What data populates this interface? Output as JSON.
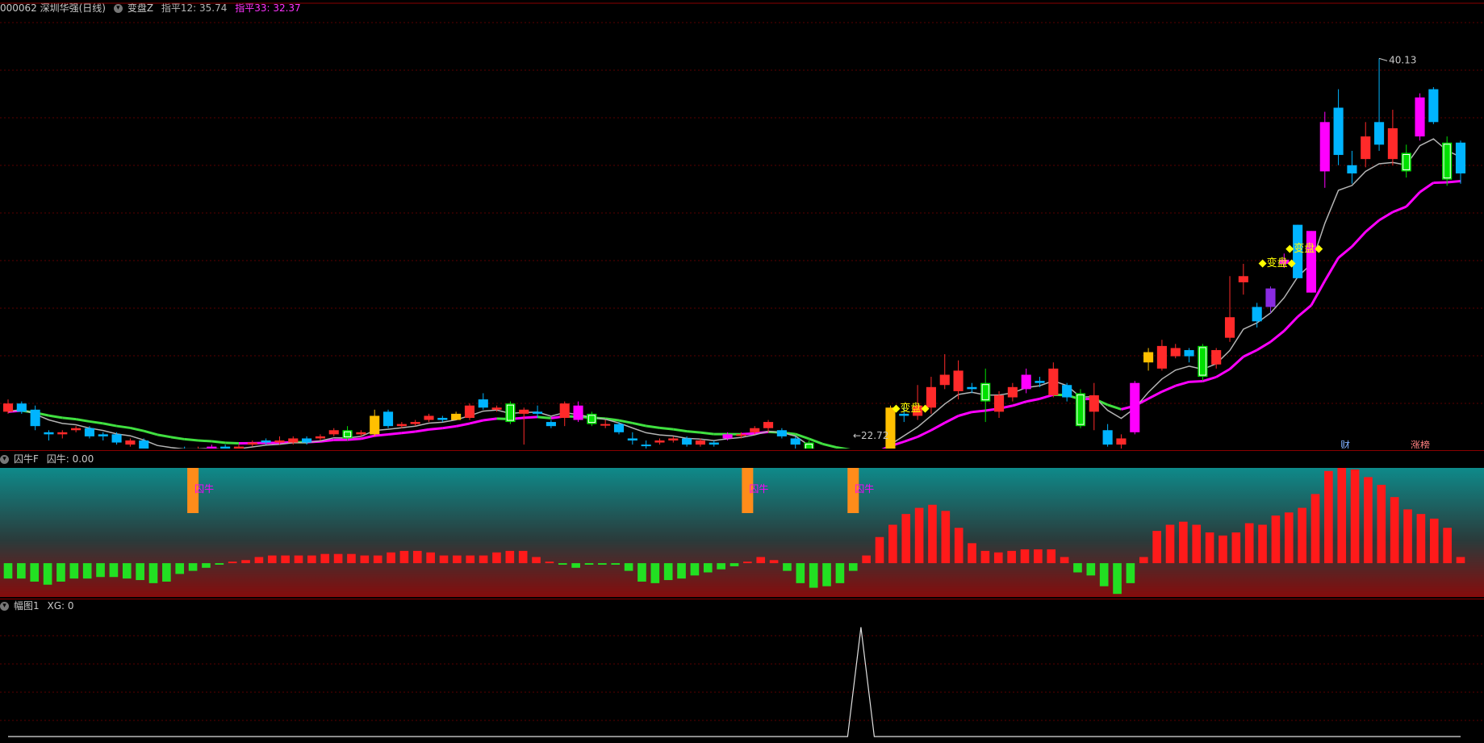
{
  "header": {
    "symbol": "000062 深圳华强(日线)",
    "indicator_name": "变盘Z",
    "line1_text": "指平12: 35.74",
    "line2_text": "指平33: 32.37"
  },
  "annotations": {
    "high_label": "40.13",
    "low_label": "←22.72",
    "signal_label": "◆变盘◆",
    "cai_label": "财",
    "zhangbang_label": "涨榜"
  },
  "panel2": {
    "name": "囚牛F",
    "value_text": "囚牛: 0.00",
    "signal_label": "囚牛"
  },
  "panel3": {
    "name": "幅图1",
    "value_text": "XG: 0"
  },
  "colors": {
    "up": "#ff2a2a",
    "down": "#00b4ff",
    "green_bar": "#00e000",
    "magenta": "#ff00ff",
    "yellow": "#ffc000",
    "orange": "#ff8c1a",
    "ma_gray": "#b4b4b4",
    "ma_green": "#40e040",
    "ma_magenta": "#ff00ff",
    "header_magenta": "#ff33ff",
    "signal_yellow": "#ffff00"
  },
  "chart_data": [
    {
      "type": "candlestick",
      "title": "000062 深圳华强(日线)",
      "ylim": [
        21.5,
        42.0
      ],
      "candles": [
        {
          "o": 23.3,
          "c": 22.9,
          "h": 23.5,
          "l": 22.8,
          "k": "up"
        },
        {
          "o": 22.9,
          "c": 23.3,
          "h": 23.4,
          "l": 22.8,
          "k": "down"
        },
        {
          "o": 23.0,
          "c": 22.2,
          "h": 23.2,
          "l": 22.0,
          "k": "down"
        },
        {
          "o": 21.9,
          "c": 21.8,
          "h": 22.0,
          "l": 21.5,
          "k": "down"
        },
        {
          "o": 21.8,
          "c": 21.9,
          "h": 22.0,
          "l": 21.6,
          "k": "up"
        },
        {
          "o": 22.0,
          "c": 22.1,
          "h": 22.2,
          "l": 21.9,
          "k": "up"
        },
        {
          "o": 22.1,
          "c": 21.7,
          "h": 22.2,
          "l": 21.6,
          "k": "down"
        },
        {
          "o": 21.8,
          "c": 21.7,
          "h": 21.9,
          "l": 21.5,
          "k": "down"
        },
        {
          "o": 21.8,
          "c": 21.4,
          "h": 21.9,
          "l": 21.3,
          "k": "down"
        },
        {
          "o": 21.3,
          "c": 21.5,
          "h": 21.6,
          "l": 21.2,
          "k": "up"
        },
        {
          "o": 21.5,
          "c": 21.0,
          "h": 21.6,
          "l": 21.0,
          "k": "down"
        },
        {
          "o": 21.0,
          "c": 20.6,
          "h": 21.1,
          "l": 20.5,
          "k": "down"
        },
        {
          "o": 20.6,
          "c": 20.9,
          "h": 21.0,
          "l": 20.4,
          "k": "up"
        },
        {
          "o": 20.9,
          "c": 20.9,
          "h": 21.2,
          "l": 20.7,
          "k": "down"
        },
        {
          "o": 20.9,
          "c": 21.1,
          "h": 21.2,
          "l": 20.8,
          "k": "up"
        },
        {
          "o": 21.1,
          "c": 21.2,
          "h": 21.3,
          "l": 21.0,
          "k": "magenta"
        },
        {
          "o": 21.2,
          "c": 20.9,
          "h": 21.3,
          "l": 20.8,
          "k": "down"
        },
        {
          "o": 21.0,
          "c": 21.2,
          "h": 21.3,
          "l": 20.9,
          "k": "up"
        },
        {
          "o": 21.3,
          "c": 21.4,
          "h": 21.5,
          "l": 21.2,
          "k": "up"
        },
        {
          "o": 21.4,
          "c": 21.5,
          "h": 21.6,
          "l": 21.3,
          "k": "down"
        },
        {
          "o": 21.5,
          "c": 21.4,
          "h": 21.7,
          "l": 21.3,
          "k": "up"
        },
        {
          "o": 21.4,
          "c": 21.6,
          "h": 21.7,
          "l": 21.3,
          "k": "up"
        },
        {
          "o": 21.6,
          "c": 21.4,
          "h": 21.7,
          "l": 21.3,
          "k": "down"
        },
        {
          "o": 21.6,
          "c": 21.7,
          "h": 21.8,
          "l": 21.5,
          "k": "up"
        },
        {
          "o": 21.8,
          "c": 22.0,
          "h": 22.1,
          "l": 21.7,
          "k": "up"
        },
        {
          "o": 22.0,
          "c": 21.6,
          "h": 22.2,
          "l": 21.5,
          "k": "green"
        },
        {
          "o": 21.8,
          "c": 21.9,
          "h": 22.0,
          "l": 21.7,
          "k": "up"
        },
        {
          "o": 21.8,
          "c": 22.7,
          "h": 23.0,
          "l": 21.7,
          "k": "yellow"
        },
        {
          "o": 22.9,
          "c": 22.2,
          "h": 23.0,
          "l": 22.1,
          "k": "down"
        },
        {
          "o": 22.2,
          "c": 22.3,
          "h": 22.4,
          "l": 22.1,
          "k": "up"
        },
        {
          "o": 22.3,
          "c": 22.4,
          "h": 22.5,
          "l": 22.2,
          "k": "up"
        },
        {
          "o": 22.5,
          "c": 22.7,
          "h": 22.8,
          "l": 22.4,
          "k": "up"
        },
        {
          "o": 22.6,
          "c": 22.5,
          "h": 22.7,
          "l": 22.4,
          "k": "down"
        },
        {
          "o": 22.5,
          "c": 22.8,
          "h": 22.9,
          "l": 22.5,
          "k": "yellow"
        },
        {
          "o": 22.6,
          "c": 23.2,
          "h": 23.3,
          "l": 22.5,
          "k": "up"
        },
        {
          "o": 23.1,
          "c": 23.5,
          "h": 23.8,
          "l": 23.0,
          "k": "down"
        },
        {
          "o": 23.0,
          "c": 23.1,
          "h": 23.2,
          "l": 22.9,
          "k": "up"
        },
        {
          "o": 23.3,
          "c": 22.4,
          "h": 23.4,
          "l": 22.3,
          "k": "green"
        },
        {
          "o": 22.8,
          "c": 23.0,
          "h": 23.1,
          "l": 21.3,
          "k": "up"
        },
        {
          "o": 22.8,
          "c": 22.9,
          "h": 23.2,
          "l": 22.6,
          "k": "down"
        },
        {
          "o": 22.4,
          "c": 22.2,
          "h": 22.5,
          "l": 22.1,
          "k": "down"
        },
        {
          "o": 22.6,
          "c": 23.3,
          "h": 23.4,
          "l": 22.2,
          "k": "up"
        },
        {
          "o": 23.2,
          "c": 22.5,
          "h": 23.4,
          "l": 22.4,
          "k": "magenta"
        },
        {
          "o": 22.8,
          "c": 22.3,
          "h": 22.9,
          "l": 22.2,
          "k": "green"
        },
        {
          "o": 22.3,
          "c": 22.3,
          "h": 22.5,
          "l": 22.1,
          "k": "up"
        },
        {
          "o": 22.3,
          "c": 21.9,
          "h": 22.4,
          "l": 21.8,
          "k": "down"
        },
        {
          "o": 21.6,
          "c": 21.5,
          "h": 21.9,
          "l": 21.3,
          "k": "down"
        },
        {
          "o": 21.3,
          "c": 21.3,
          "h": 21.5,
          "l": 21.0,
          "k": "down"
        },
        {
          "o": 21.4,
          "c": 21.5,
          "h": 21.6,
          "l": 21.3,
          "k": "up"
        },
        {
          "o": 21.5,
          "c": 21.6,
          "h": 21.7,
          "l": 21.4,
          "k": "up"
        },
        {
          "o": 21.6,
          "c": 21.3,
          "h": 21.7,
          "l": 21.2,
          "k": "down"
        },
        {
          "o": 21.3,
          "c": 21.5,
          "h": 21.6,
          "l": 21.2,
          "k": "up"
        },
        {
          "o": 21.4,
          "c": 21.3,
          "h": 21.5,
          "l": 21.2,
          "k": "down"
        },
        {
          "o": 21.6,
          "c": 21.8,
          "h": 21.9,
          "l": 21.5,
          "k": "magenta"
        },
        {
          "o": 21.8,
          "c": 21.8,
          "h": 21.9,
          "l": 21.6,
          "k": "up"
        },
        {
          "o": 21.9,
          "c": 22.1,
          "h": 22.2,
          "l": 21.8,
          "k": "up"
        },
        {
          "o": 22.1,
          "c": 22.4,
          "h": 22.5,
          "l": 21.9,
          "k": "up"
        },
        {
          "o": 22.0,
          "c": 21.7,
          "h": 22.1,
          "l": 21.6,
          "k": "down"
        },
        {
          "o": 21.6,
          "c": 21.3,
          "h": 21.7,
          "l": 21.0,
          "k": "down"
        },
        {
          "o": 21.4,
          "c": 20.1,
          "h": 21.5,
          "l": 20.0,
          "k": "green"
        },
        {
          "o": 20.1,
          "c": 19.7,
          "h": 20.2,
          "l": 19.6,
          "k": "down"
        },
        {
          "o": 19.9,
          "c": 20.1,
          "h": 20.2,
          "l": 19.8,
          "k": "up"
        },
        {
          "o": 20.0,
          "c": 20.3,
          "h": 20.4,
          "l": 19.8,
          "k": "up"
        },
        {
          "o": 20.0,
          "c": 20.3,
          "h": 20.5,
          "l": 19.9,
          "k": "up"
        },
        {
          "o": 20.8,
          "c": 20.9,
          "h": 21.0,
          "l": 20.6,
          "k": "up"
        },
        {
          "o": 20.7,
          "c": 23.1,
          "h": 23.2,
          "l": 20.6,
          "k": "yellow"
        },
        {
          "o": 22.7,
          "c": 22.8,
          "h": 23.2,
          "l": 22.4,
          "k": "down"
        },
        {
          "o": 22.7,
          "c": 23.2,
          "h": 24.2,
          "l": 22.5,
          "k": "up"
        },
        {
          "o": 23.1,
          "c": 24.1,
          "h": 24.6,
          "l": 22.8,
          "k": "up"
        },
        {
          "o": 24.2,
          "c": 24.7,
          "h": 25.7,
          "l": 24.0,
          "k": "up"
        },
        {
          "o": 23.9,
          "c": 24.9,
          "h": 25.4,
          "l": 23.5,
          "k": "up"
        },
        {
          "o": 24.0,
          "c": 24.1,
          "h": 24.3,
          "l": 23.8,
          "k": "down"
        },
        {
          "o": 24.3,
          "c": 23.4,
          "h": 25.0,
          "l": 22.4,
          "k": "green"
        },
        {
          "o": 22.9,
          "c": 23.7,
          "h": 23.9,
          "l": 22.6,
          "k": "up"
        },
        {
          "o": 23.6,
          "c": 24.1,
          "h": 24.3,
          "l": 23.4,
          "k": "up"
        },
        {
          "o": 24.0,
          "c": 24.7,
          "h": 25.0,
          "l": 23.8,
          "k": "magenta"
        },
        {
          "o": 24.3,
          "c": 24.4,
          "h": 24.6,
          "l": 24.1,
          "k": "down"
        },
        {
          "o": 23.7,
          "c": 25.0,
          "h": 25.3,
          "l": 23.6,
          "k": "up"
        },
        {
          "o": 24.2,
          "c": 23.6,
          "h": 24.3,
          "l": 23.4,
          "k": "down"
        },
        {
          "o": 23.8,
          "c": 22.2,
          "h": 24.0,
          "l": 22.1,
          "k": "green"
        },
        {
          "o": 22.9,
          "c": 23.7,
          "h": 24.3,
          "l": 22.0,
          "k": "up"
        },
        {
          "o": 22.0,
          "c": 21.3,
          "h": 22.3,
          "l": 21.2,
          "k": "down"
        },
        {
          "o": 21.3,
          "c": 21.6,
          "h": 21.8,
          "l": 21.0,
          "k": "up"
        },
        {
          "o": 21.9,
          "c": 24.3,
          "h": 24.4,
          "l": 21.8,
          "k": "magenta"
        },
        {
          "o": 25.3,
          "c": 25.8,
          "h": 26.0,
          "l": 24.9,
          "k": "yellow"
        },
        {
          "o": 25.0,
          "c": 26.1,
          "h": 26.4,
          "l": 24.9,
          "k": "up"
        },
        {
          "o": 25.6,
          "c": 26.0,
          "h": 26.2,
          "l": 25.5,
          "k": "up"
        },
        {
          "o": 25.9,
          "c": 25.6,
          "h": 26.0,
          "l": 25.3,
          "k": "down"
        },
        {
          "o": 26.1,
          "c": 24.6,
          "h": 26.2,
          "l": 24.4,
          "k": "green"
        },
        {
          "o": 25.2,
          "c": 25.9,
          "h": 26.0,
          "l": 25.0,
          "k": "up"
        },
        {
          "o": 26.5,
          "c": 27.5,
          "h": 29.5,
          "l": 26.3,
          "k": "up"
        },
        {
          "o": 29.2,
          "c": 29.5,
          "h": 30.1,
          "l": 28.6,
          "k": "up"
        },
        {
          "o": 27.3,
          "c": 28.0,
          "h": 28.2,
          "l": 27.0,
          "k": "down"
        },
        {
          "o": 28.0,
          "c": 28.9,
          "h": 29.0,
          "l": 27.7,
          "k": "purple"
        },
        {
          "o": 30.1,
          "c": 30.3,
          "h": 30.6,
          "l": 29.9,
          "k": "magenta"
        },
        {
          "o": 29.4,
          "c": 32.0,
          "h": 32.0,
          "l": 29.4,
          "k": "down"
        },
        {
          "o": 28.7,
          "c": 31.7,
          "h": 31.7,
          "l": 28.7,
          "k": "magenta"
        },
        {
          "o": 34.6,
          "c": 37.0,
          "h": 37.5,
          "l": 33.8,
          "k": "magenta"
        },
        {
          "o": 35.4,
          "c": 37.7,
          "h": 38.6,
          "l": 34.9,
          "k": "down"
        },
        {
          "o": 34.9,
          "c": 34.5,
          "h": 35.6,
          "l": 34.0,
          "k": "down"
        },
        {
          "o": 35.2,
          "c": 36.3,
          "h": 37.0,
          "l": 34.8,
          "k": "up"
        },
        {
          "o": 37.0,
          "c": 35.9,
          "h": 40.1,
          "l": 35.6,
          "k": "down"
        },
        {
          "o": 36.7,
          "c": 35.2,
          "h": 37.6,
          "l": 34.9,
          "k": "up"
        },
        {
          "o": 35.5,
          "c": 34.6,
          "h": 35.9,
          "l": 34.3,
          "k": "green"
        },
        {
          "o": 36.3,
          "c": 38.2,
          "h": 38.4,
          "l": 36.1,
          "k": "magenta"
        },
        {
          "o": 38.6,
          "c": 37.0,
          "h": 38.7,
          "l": 36.9,
          "k": "down"
        },
        {
          "o": 36.0,
          "c": 34.2,
          "h": 36.3,
          "l": 33.9,
          "k": "green"
        },
        {
          "o": 36.0,
          "c": 34.5,
          "h": 36.1,
          "l": 34.0,
          "k": "down"
        }
      ],
      "lines": [
        {
          "name": "指平12",
          "color": "#b4b4b4"
        },
        {
          "name": "指平33",
          "color": "#ff00ff"
        }
      ],
      "high_value": 40.13,
      "low_value": 22.72
    },
    {
      "type": "bar",
      "title": "囚牛F",
      "ylim": [
        -2.2,
        6.2
      ],
      "values": [
        -1.0,
        -1.0,
        -1.2,
        -1.4,
        -1.2,
        -1.0,
        -1.0,
        -0.9,
        -0.9,
        -1.0,
        -1.1,
        -1.3,
        -1.2,
        -0.7,
        -0.5,
        -0.3,
        -0.1,
        0.1,
        0.2,
        0.4,
        0.5,
        0.5,
        0.5,
        0.5,
        0.6,
        0.6,
        0.6,
        0.5,
        0.5,
        0.7,
        0.8,
        0.8,
        0.7,
        0.5,
        0.5,
        0.5,
        0.5,
        0.7,
        0.8,
        0.8,
        0.4,
        0.1,
        -0.1,
        -0.3,
        -0.1,
        -0.1,
        -0.1,
        -0.5,
        -1.2,
        -1.3,
        -1.1,
        -1.0,
        -0.8,
        -0.6,
        -0.4,
        -0.2,
        0.1,
        0.4,
        0.2,
        -0.5,
        -1.3,
        -1.6,
        -1.5,
        -1.3,
        -0.5,
        0.5,
        1.7,
        2.5,
        3.2,
        3.6,
        3.8,
        3.4,
        2.3,
        1.3,
        0.8,
        0.7,
        0.8,
        0.9,
        0.9,
        0.9,
        0.4,
        -0.6,
        -0.8,
        -1.5,
        -2.0,
        -1.3,
        0.4,
        2.1,
        2.5,
        2.7,
        2.5,
        2.0,
        1.8,
        2.0,
        2.6,
        2.5,
        3.1,
        3.3,
        3.6,
        4.5,
        6.0,
        6.5,
        6.1,
        5.6,
        5.1,
        4.3,
        3.5,
        3.2,
        2.9,
        2.3,
        0.4
      ],
      "signal_indices": [
        14,
        56,
        64
      ]
    },
    {
      "type": "line",
      "title": "幅图1",
      "ylim": [
        0,
        1.1
      ],
      "values_note_index": 64,
      "values": [
        0,
        0,
        0,
        0,
        0,
        0,
        0,
        0,
        0,
        0,
        0,
        0,
        0,
        0,
        0,
        0,
        0,
        0,
        0,
        0,
        0,
        0,
        0,
        0,
        0,
        0,
        0,
        0,
        0,
        0,
        0,
        0,
        0,
        0,
        0,
        0,
        0,
        0,
        0,
        0,
        0,
        0,
        0,
        0,
        0,
        0,
        0,
        0,
        0,
        0,
        0,
        0,
        0,
        0,
        0,
        0,
        0,
        0,
        0,
        0,
        0,
        0,
        0,
        0,
        1,
        0,
        0,
        0,
        0,
        0,
        0,
        0,
        0,
        0,
        0,
        0,
        0,
        0,
        0,
        0,
        0,
        0,
        0,
        0,
        0,
        0,
        0,
        0,
        0,
        0,
        0,
        0,
        0,
        0,
        0,
        0,
        0,
        0,
        0,
        0,
        0,
        0,
        0,
        0,
        0,
        0,
        0,
        0,
        0,
        0
      ]
    }
  ]
}
